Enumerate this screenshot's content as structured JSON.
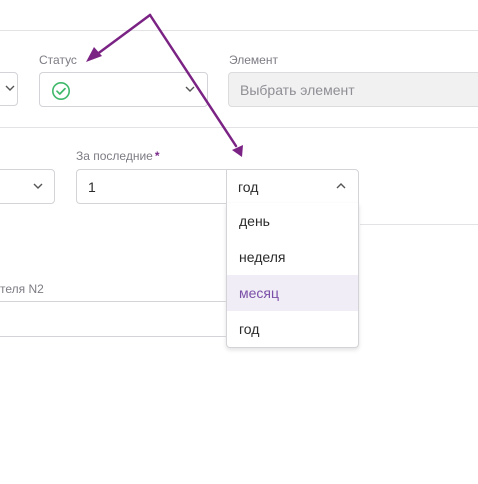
{
  "filters_row": {
    "status": {
      "label": "Статус",
      "icon": "check-circle-icon",
      "icon_color": "#3fb86b"
    },
    "element": {
      "label": "Элемент",
      "placeholder": "Выбрать элемент"
    }
  },
  "period_row": {
    "last_label": "За последние",
    "required_mark": "*",
    "count_value": "1",
    "unit_selected": "год",
    "unit_options": [
      {
        "label": "день",
        "active": false
      },
      {
        "label": "неделя",
        "active": false
      },
      {
        "label": "месяц",
        "active": true
      },
      {
        "label": "год",
        "active": false
      }
    ]
  },
  "bottom": {
    "indicator_label": "теля N2"
  },
  "colors": {
    "accent": "#7a2a8a",
    "active_option_bg": "#f0edf6",
    "active_option_text": "#7b4fa8",
    "annotation_arrow": "#7b2384"
  }
}
